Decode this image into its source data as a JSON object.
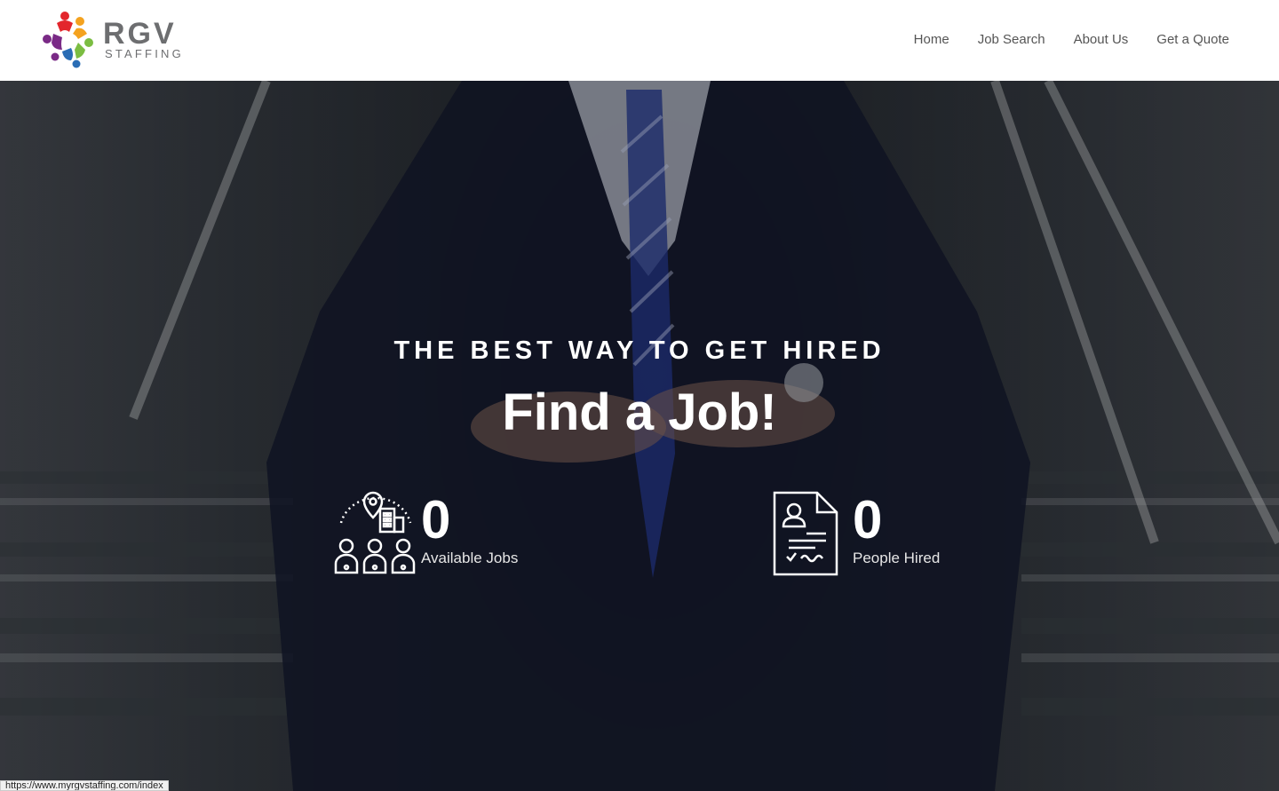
{
  "brand": {
    "name": "RGV",
    "subtitle": "STAFFING",
    "colors": {
      "text": "#6d6e70",
      "red": "#e3262c",
      "orange": "#f4a21f",
      "green": "#7bbd42",
      "blue": "#2a6db5",
      "purple": "#7a2a86"
    }
  },
  "nav": {
    "items": [
      {
        "label": "Home"
      },
      {
        "label": "Job Search"
      },
      {
        "label": "About Us"
      },
      {
        "label": "Get a Quote"
      }
    ]
  },
  "hero": {
    "tagline": "THE BEST WAY TO GET HIRED",
    "headline": "Find a Job!",
    "stats": [
      {
        "icon": "job-location-people-icon",
        "value": "0",
        "label": "Available Jobs"
      },
      {
        "icon": "resume-document-icon",
        "value": "0",
        "label": "People Hired"
      }
    ]
  },
  "status_bar": {
    "url": "https://www.myrgvstaffing.com/index"
  }
}
